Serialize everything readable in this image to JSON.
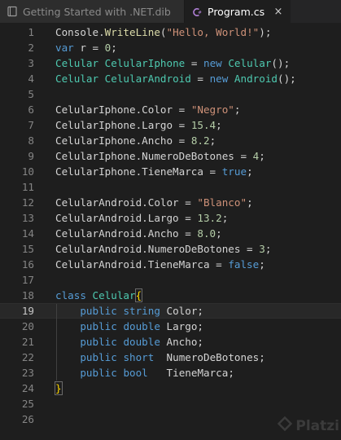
{
  "tabs": [
    {
      "label": "Getting Started with .NET.dib",
      "icon": "notebook-icon",
      "active": false
    },
    {
      "label": "Program.cs",
      "icon": "csharp-file-icon",
      "active": true,
      "close_glyph": "×"
    }
  ],
  "editor": {
    "current_line": 19,
    "lines": [
      {
        "n": "1",
        "tokens": [
          [
            "Console.",
            "t-plain"
          ],
          [
            "WriteLine",
            "t-method"
          ],
          [
            "(",
            "t-plain"
          ],
          [
            "\"Hello, World!\"",
            "t-string"
          ],
          [
            ");",
            "t-plain"
          ]
        ]
      },
      {
        "n": "2",
        "tokens": [
          [
            "var",
            "t-keyword"
          ],
          [
            " r = ",
            "t-plain"
          ],
          [
            "0",
            "t-number"
          ],
          [
            ";",
            "t-plain"
          ]
        ]
      },
      {
        "n": "3",
        "tokens": [
          [
            "Celular",
            "t-type"
          ],
          [
            " ",
            "t-plain"
          ],
          [
            "CelularIphone",
            "t-type"
          ],
          [
            " = ",
            "t-plain"
          ],
          [
            "new",
            "t-keyword"
          ],
          [
            " ",
            "t-plain"
          ],
          [
            "Celular",
            "t-type"
          ],
          [
            "();",
            "t-plain"
          ]
        ]
      },
      {
        "n": "4",
        "tokens": [
          [
            "Celular",
            "t-type"
          ],
          [
            " ",
            "t-plain"
          ],
          [
            "CelularAndroid",
            "t-type"
          ],
          [
            " = ",
            "t-plain"
          ],
          [
            "new",
            "t-keyword"
          ],
          [
            " ",
            "t-plain"
          ],
          [
            "Android",
            "t-type"
          ],
          [
            "();",
            "t-plain"
          ]
        ]
      },
      {
        "n": "5",
        "tokens": []
      },
      {
        "n": "6",
        "tokens": [
          [
            "CelularIphone.Color = ",
            "t-plain"
          ],
          [
            "\"Negro\"",
            "t-string"
          ],
          [
            ";",
            "t-plain"
          ]
        ]
      },
      {
        "n": "7",
        "tokens": [
          [
            "CelularIphone.Largo = ",
            "t-plain"
          ],
          [
            "15.4",
            "t-number"
          ],
          [
            ";",
            "t-plain"
          ]
        ]
      },
      {
        "n": "8",
        "tokens": [
          [
            "CelularIphone.Ancho = ",
            "t-plain"
          ],
          [
            "8.2",
            "t-number"
          ],
          [
            ";",
            "t-plain"
          ]
        ]
      },
      {
        "n": "9",
        "tokens": [
          [
            "CelularIphone.NumeroDeBotones = ",
            "t-plain"
          ],
          [
            "4",
            "t-number"
          ],
          [
            ";",
            "t-plain"
          ]
        ]
      },
      {
        "n": "10",
        "tokens": [
          [
            "CelularIphone.TieneMarca = ",
            "t-plain"
          ],
          [
            "true",
            "t-keyword"
          ],
          [
            ";",
            "t-plain"
          ]
        ]
      },
      {
        "n": "11",
        "tokens": []
      },
      {
        "n": "12",
        "tokens": [
          [
            "CelularAndroid.Color = ",
            "t-plain"
          ],
          [
            "\"Blanco\"",
            "t-string"
          ],
          [
            ";",
            "t-plain"
          ]
        ]
      },
      {
        "n": "13",
        "tokens": [
          [
            "CelularAndroid.Largo = ",
            "t-plain"
          ],
          [
            "13.2",
            "t-number"
          ],
          [
            ";",
            "t-plain"
          ]
        ]
      },
      {
        "n": "14",
        "tokens": [
          [
            "CelularAndroid.Ancho = ",
            "t-plain"
          ],
          [
            "8.0",
            "t-number"
          ],
          [
            ";",
            "t-plain"
          ]
        ]
      },
      {
        "n": "15",
        "tokens": [
          [
            "CelularAndroid.NumeroDeBotones = ",
            "t-plain"
          ],
          [
            "3",
            "t-number"
          ],
          [
            ";",
            "t-plain"
          ]
        ]
      },
      {
        "n": "16",
        "tokens": [
          [
            "CelularAndroid.TieneMarca = ",
            "t-plain"
          ],
          [
            "false",
            "t-keyword"
          ],
          [
            ";",
            "t-plain"
          ]
        ]
      },
      {
        "n": "17",
        "tokens": []
      },
      {
        "n": "18",
        "tokens": [
          [
            "class",
            "t-keyword"
          ],
          [
            " ",
            "t-plain"
          ],
          [
            "Celular",
            "t-type"
          ],
          [
            "{",
            "t-bracket-box"
          ]
        ]
      },
      {
        "n": "19",
        "indent": true,
        "tokens": [
          [
            "    ",
            "t-plain"
          ],
          [
            "public",
            "t-keyword"
          ],
          [
            " ",
            "t-plain"
          ],
          [
            "string",
            "t-keyword"
          ],
          [
            " Color;",
            "t-plain"
          ]
        ]
      },
      {
        "n": "20",
        "indent": true,
        "tokens": [
          [
            "    ",
            "t-plain"
          ],
          [
            "public",
            "t-keyword"
          ],
          [
            " ",
            "t-plain"
          ],
          [
            "double",
            "t-keyword"
          ],
          [
            " Largo;",
            "t-plain"
          ]
        ]
      },
      {
        "n": "21",
        "indent": true,
        "tokens": [
          [
            "    ",
            "t-plain"
          ],
          [
            "public",
            "t-keyword"
          ],
          [
            " ",
            "t-plain"
          ],
          [
            "double",
            "t-keyword"
          ],
          [
            " Ancho;",
            "t-plain"
          ]
        ]
      },
      {
        "n": "22",
        "indent": true,
        "tokens": [
          [
            "    ",
            "t-plain"
          ],
          [
            "public",
            "t-keyword"
          ],
          [
            " ",
            "t-plain"
          ],
          [
            "short",
            "t-keyword"
          ],
          [
            "  NumeroDeBotones;",
            "t-plain"
          ]
        ]
      },
      {
        "n": "23",
        "indent": true,
        "tokens": [
          [
            "    ",
            "t-plain"
          ],
          [
            "public",
            "t-keyword"
          ],
          [
            " ",
            "t-plain"
          ],
          [
            "bool",
            "t-keyword"
          ],
          [
            "   TieneMarca;",
            "t-plain"
          ]
        ]
      },
      {
        "n": "24",
        "tokens": [
          [
            "}",
            "t-bracket-box"
          ]
        ]
      },
      {
        "n": "25",
        "tokens": []
      },
      {
        "n": "26",
        "tokens": []
      }
    ]
  },
  "watermark": {
    "text": "Platzi",
    "icon": "platzi-logo-icon"
  },
  "colors": {
    "background": "#1e1e1e",
    "tab_bar": "#252526",
    "keyword": "#569cd6",
    "type": "#4ec9b0",
    "string": "#ce9178",
    "number": "#b5cea8",
    "method": "#dcdcaa",
    "bracket": "#ffd700"
  }
}
